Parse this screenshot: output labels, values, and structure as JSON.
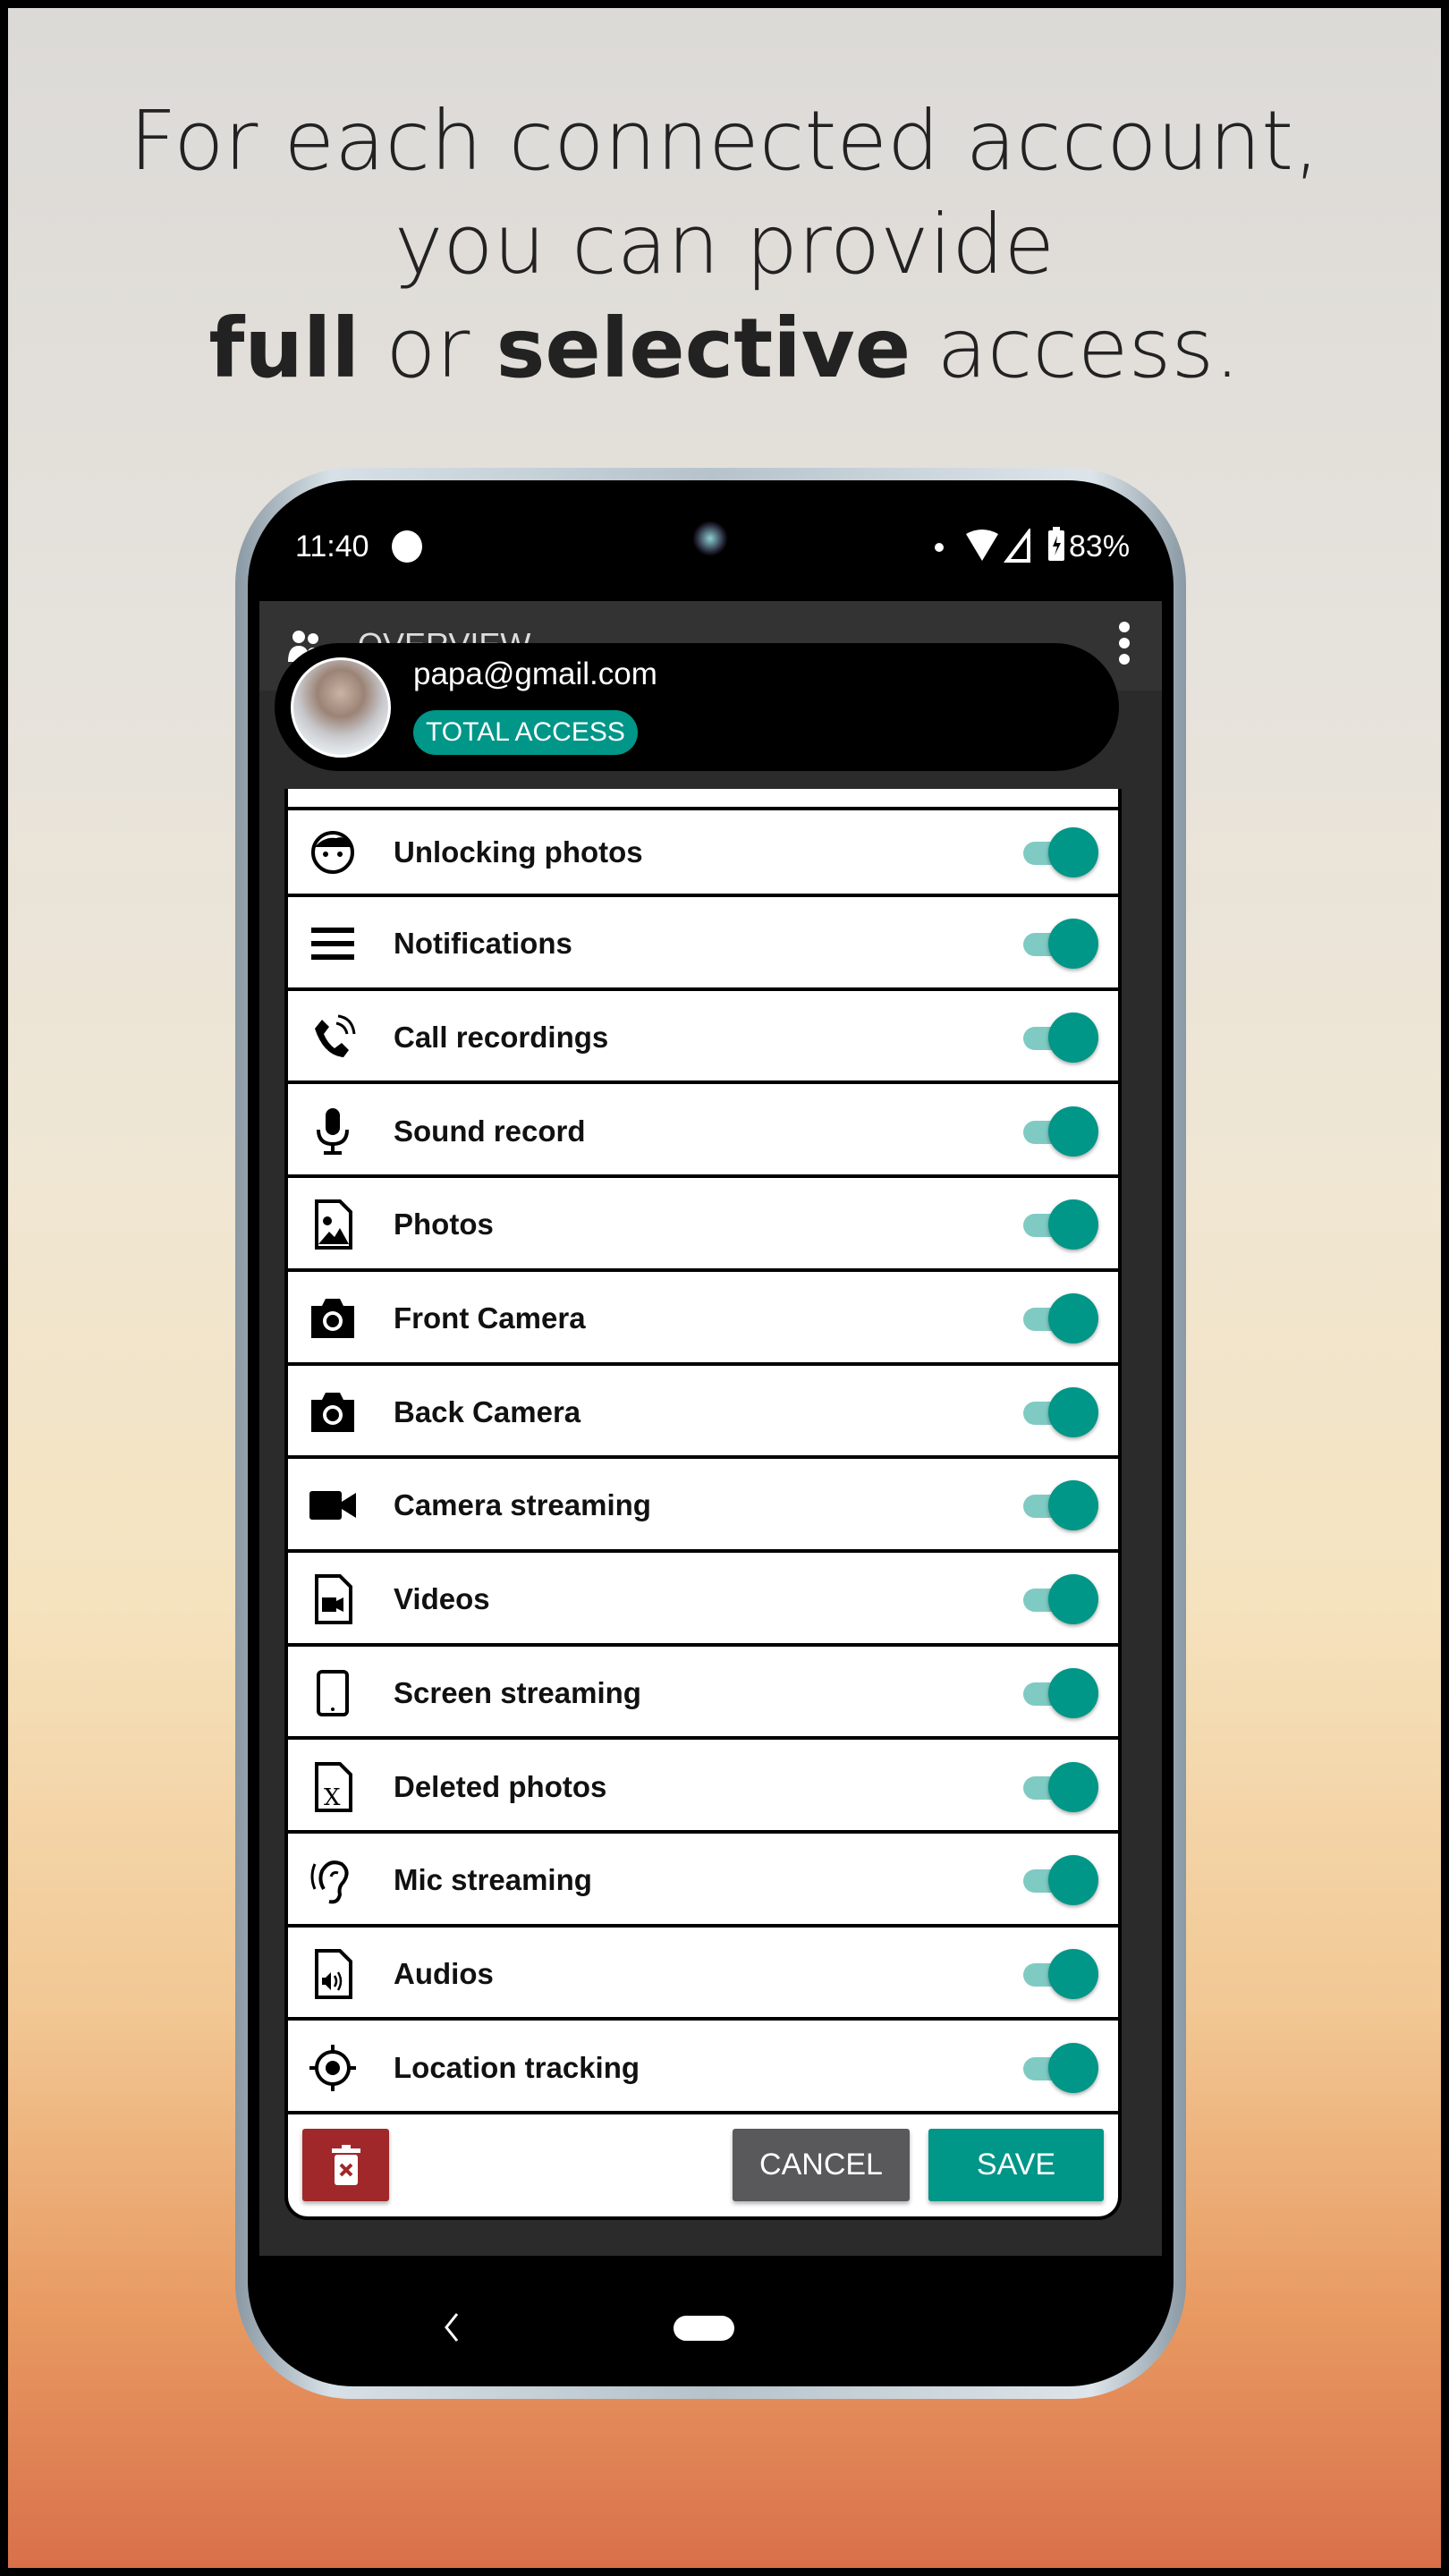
{
  "headline": {
    "line1": "For each connected account,",
    "line2": "you can provide",
    "bold1": "full",
    "mid": " or ",
    "bold2": "selective",
    "end": " access."
  },
  "status_bar": {
    "time": "11:40",
    "battery": "83%"
  },
  "app_bar": {
    "title": "OVERVIEW"
  },
  "account": {
    "email": "papa@gmail.com",
    "badge": "TOTAL ACCESS"
  },
  "colors": {
    "accent": "#009688",
    "delete": "#a0282a",
    "cancel": "#59595b"
  },
  "permissions": [
    {
      "label": "Unlocking photos",
      "icon": "face-icon",
      "enabled": true
    },
    {
      "label": "Notifications",
      "icon": "menu-lines-icon",
      "enabled": true
    },
    {
      "label": "Call recordings",
      "icon": "phone-ringing-icon",
      "enabled": true
    },
    {
      "label": "Sound record",
      "icon": "microphone-icon",
      "enabled": true
    },
    {
      "label": "Photos",
      "icon": "image-file-icon",
      "enabled": true
    },
    {
      "label": "Front Camera",
      "icon": "camera-icon",
      "enabled": true
    },
    {
      "label": "Back Camera",
      "icon": "camera-icon",
      "enabled": true
    },
    {
      "label": "Camera streaming",
      "icon": "video-camera-icon",
      "enabled": true
    },
    {
      "label": "Videos",
      "icon": "video-file-icon",
      "enabled": true
    },
    {
      "label": "Screen streaming",
      "icon": "tablet-icon",
      "enabled": true
    },
    {
      "label": "Deleted photos",
      "icon": "deleted-file-icon",
      "enabled": true
    },
    {
      "label": "Mic streaming",
      "icon": "ear-icon",
      "enabled": true
    },
    {
      "label": "Audios",
      "icon": "audio-file-icon",
      "enabled": true
    },
    {
      "label": "Location tracking",
      "icon": "crosshair-icon",
      "enabled": true
    }
  ],
  "actions": {
    "cancel": "CANCEL",
    "save": "SAVE"
  }
}
